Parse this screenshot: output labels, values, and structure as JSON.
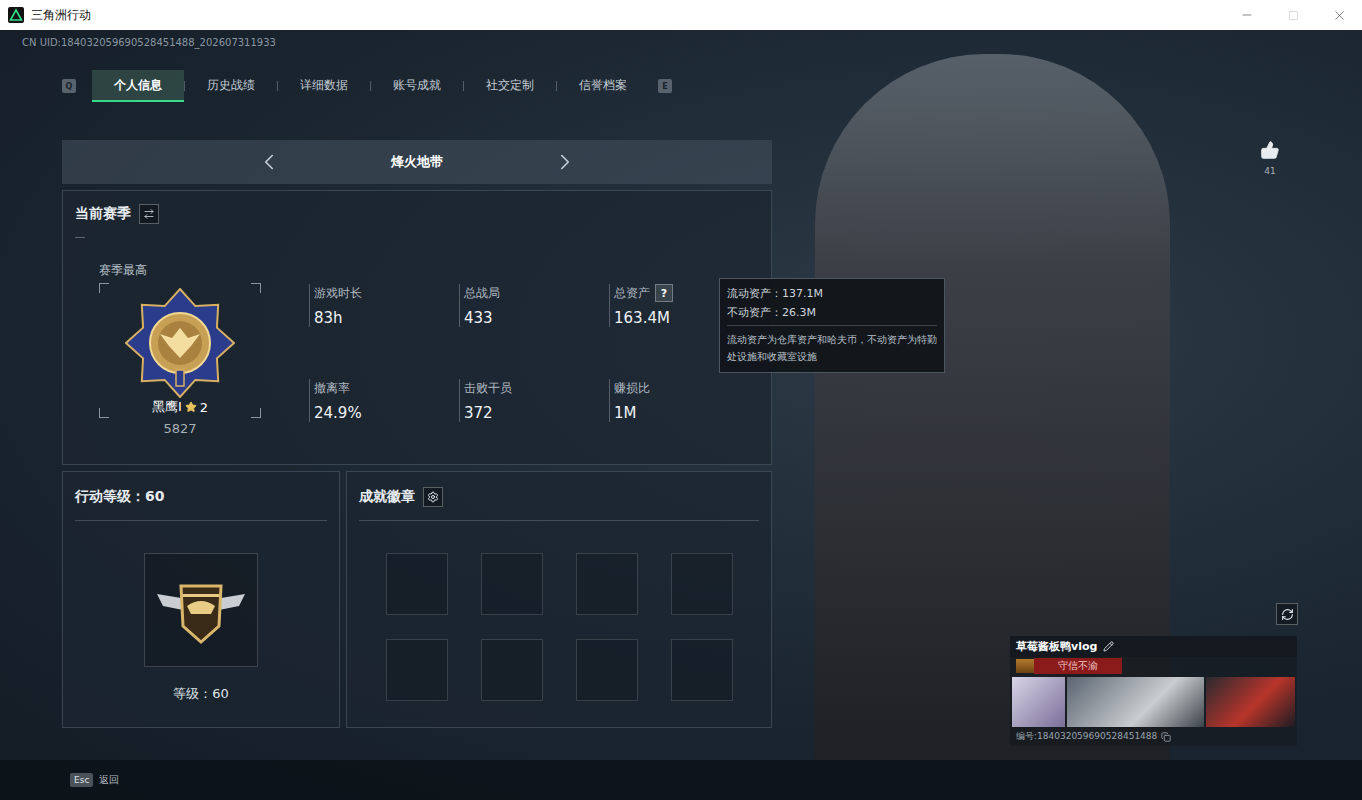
{
  "window": {
    "title": "三角洲行动"
  },
  "uid": "CN UID:184032059690528451488_202607311933",
  "tabs": {
    "prev_key": "Q",
    "next_key": "E",
    "items": [
      {
        "label": "个人信息",
        "selected": true
      },
      {
        "label": "历史战绩",
        "selected": false
      },
      {
        "label": "详细数据",
        "selected": false
      },
      {
        "label": "账号成就",
        "selected": false
      },
      {
        "label": "社交定制",
        "selected": false
      },
      {
        "label": "信誉档案",
        "selected": false
      }
    ]
  },
  "mode_selector": {
    "label": "烽火地带"
  },
  "season": {
    "title": "当前赛季",
    "best_label": "赛季最高",
    "rank": "黑鹰Ⅰ",
    "star_count": "2",
    "score": "5827",
    "stats": [
      {
        "label": "游戏时长",
        "value": "83h",
        "kind": "plain"
      },
      {
        "label": "总战局",
        "value": "433",
        "kind": "plain"
      },
      {
        "label": "总资产",
        "value": "163.4M",
        "kind": "with-help",
        "help_icon": "?"
      },
      {
        "label": "撤离率",
        "value": "24.9%",
        "kind": "plain"
      },
      {
        "label": "击败干员",
        "value": "372",
        "kind": "plain"
      },
      {
        "label": "赚损比",
        "value": "1M",
        "kind": "plain"
      }
    ]
  },
  "tooltip": {
    "lines": [
      "流动资产：137.1M",
      "不动资产：26.3M"
    ],
    "note": "流动资产为仓库资产和哈夫币，不动资产为特勤处设施和收藏室设施"
  },
  "level_panel": {
    "title": "行动等级：60",
    "caption": "等级：60"
  },
  "badges_panel": {
    "title": "成就徽章",
    "slots": [
      {
        "empty": true
      },
      {
        "empty": true
      },
      {
        "empty": true
      },
      {
        "empty": true
      },
      {
        "empty": true
      },
      {
        "empty": true
      },
      {
        "empty": true
      },
      {
        "empty": true
      }
    ]
  },
  "profile": {
    "likes": "41",
    "name": "草莓酱板鸭vlog",
    "tag": "守信不渝",
    "id": "编号:184032059690528451488"
  },
  "footer": {
    "key": "Esc",
    "label": "返回"
  }
}
